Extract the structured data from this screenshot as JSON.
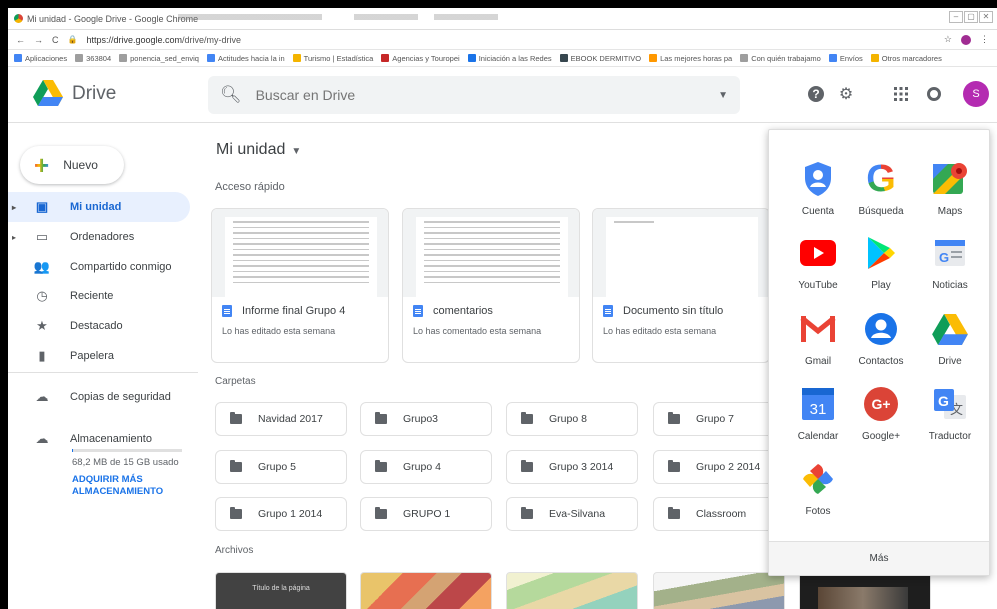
{
  "browser": {
    "title": "Mi unidad - Google Drive - Google Chrome",
    "url_host": "https://drive.google.com",
    "url_path": "/drive/my-drive",
    "window_controls": [
      "–",
      "▢",
      "✕"
    ],
    "bookmarks": [
      {
        "label": "Aplicaciones",
        "color": "#4285f4"
      },
      {
        "label": "363804",
        "color": "#9e9e9e"
      },
      {
        "label": "ponencia_sed_enviq",
        "color": "#9e9e9e"
      },
      {
        "label": "Actitudes hacia la in",
        "color": "#4285f4"
      },
      {
        "label": "Turismo | Estadística",
        "color": "#f4b400"
      },
      {
        "label": "Agencias y Touropei",
        "color": "#c62828"
      },
      {
        "label": "Iniciación a las Redes",
        "color": "#1a73e8"
      },
      {
        "label": "EBOOK DERMITIVO",
        "color": "#37474f"
      },
      {
        "label": "Las mejores horas pa",
        "color": "#ff9800"
      },
      {
        "label": "Con quién trabajamo",
        "color": "#9e9e9e"
      },
      {
        "label": "Envíos",
        "color": "#4285f4"
      },
      {
        "label": "Otros marcadores",
        "color": "#f4b400"
      }
    ]
  },
  "header": {
    "brand": "Drive",
    "search_placeholder": "Buscar en Drive",
    "avatar_letter": "S",
    "avatar_color": "#b42bb1"
  },
  "sidebar": {
    "new_label": "Nuevo",
    "items": [
      {
        "label": "Mi unidad",
        "icon": "my-drive-icon",
        "glyph": "▣",
        "active": true,
        "arrow": "▸"
      },
      {
        "label": "Ordenadores",
        "icon": "computers-icon",
        "glyph": "▭",
        "active": false,
        "arrow": "▸"
      },
      {
        "label": "Compartido conmigo",
        "icon": "shared-icon",
        "glyph": "👥",
        "active": false,
        "arrow": ""
      },
      {
        "label": "Reciente",
        "icon": "clock-icon",
        "glyph": "◷",
        "active": false,
        "arrow": ""
      },
      {
        "label": "Destacado",
        "icon": "star-icon",
        "glyph": "★",
        "active": false,
        "arrow": ""
      },
      {
        "label": "Papelera",
        "icon": "trash-icon",
        "glyph": "▮",
        "active": false,
        "arrow": ""
      },
      {
        "label": "Copias de seguridad",
        "icon": "cloud-backup-icon",
        "glyph": "☁",
        "active": false,
        "arrow": ""
      },
      {
        "label": "Almacenamiento",
        "icon": "cloud-storage-icon",
        "glyph": "☁",
        "active": false,
        "arrow": ""
      }
    ],
    "storage_used": "68,2 MB de 15 GB usado",
    "storage_fraction": 0.0045,
    "buy_storage": "ADQUIRIR MÁS ALMACENAMIENTO"
  },
  "main": {
    "title": "Mi unidad",
    "quick_access_title": "Acceso rápido",
    "quick_access": [
      {
        "name": "Informe final Grupo 4",
        "sub": "Lo has editado esta semana"
      },
      {
        "name": "comentarios",
        "sub": "Lo has comentado esta semana"
      },
      {
        "name": "Documento sin título",
        "sub": "Lo has editado esta semana"
      }
    ],
    "folders_title": "Carpetas",
    "folders": [
      "Navidad 2017",
      "Grupo3",
      "Grupo 8",
      "Grupo 7",
      "Grupo 5",
      "Grupo 4",
      "Grupo 3 2014",
      "Grupo 2 2014",
      "Grupo 1 2014",
      "GRUPO 1",
      "Eva-Silvana",
      "Classroom"
    ],
    "files_title": "Archivos",
    "file_thumb_caption": "Título de la página"
  },
  "apps_panel": {
    "apps": [
      {
        "label": "Cuenta",
        "icon": "account-icon"
      },
      {
        "label": "Búsqueda",
        "icon": "google-search-icon"
      },
      {
        "label": "Maps",
        "icon": "maps-icon"
      },
      {
        "label": "YouTube",
        "icon": "youtube-icon"
      },
      {
        "label": "Play",
        "icon": "play-store-icon"
      },
      {
        "label": "Noticias",
        "icon": "news-icon"
      },
      {
        "label": "Gmail",
        "icon": "gmail-icon"
      },
      {
        "label": "Contactos",
        "icon": "contacts-icon"
      },
      {
        "label": "Drive",
        "icon": "drive-icon"
      },
      {
        "label": "Calendar",
        "icon": "calendar-icon",
        "day": "31"
      },
      {
        "label": "Google+",
        "icon": "google-plus-icon",
        "text": "G+"
      },
      {
        "label": "Traductor",
        "icon": "translate-icon"
      },
      {
        "label": "Fotos",
        "icon": "photos-icon"
      }
    ],
    "more_label": "Más"
  }
}
